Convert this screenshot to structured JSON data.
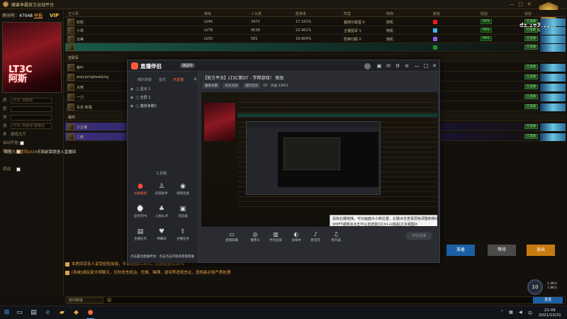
{
  "app": {
    "title": "魔兽争霸官方对战平台",
    "window_controls": [
      "—",
      "□",
      "✕"
    ]
  },
  "room": {
    "label": "房间号：",
    "number": "47048",
    "action": "举报",
    "vip": "VIP",
    "banner_text": "LT3C\n阿斯",
    "fields": [
      {
        "label": "房",
        "value": "LT3C 阿斯好"
      },
      {
        "label": "密",
        "value": ""
      },
      {
        "label": "类",
        "value": ""
      },
      {
        "label": "说",
        "value": "LT3C 阿斯好 联赛前"
      },
      {
        "label": "来",
        "value": "游戏大厅"
      },
      {
        "label": "自动开始",
        "value": ""
      },
      {
        "label": "裁判",
        "value": ""
      },
      {
        "label": "观战",
        "value": ""
      }
    ],
    "welcome": "欢迎",
    "welcome_user": "大部管司",
    "welcome_level": "LV14",
    "welcome_suffix": "天局前荣提进入直播间"
  },
  "table": {
    "headers": [
      "王父军",
      "等级",
      "人头数",
      "胜率率",
      "阵营",
      "种族",
      "颜色",
      "经验",
      "状态"
    ],
    "team_a": "王父军",
    "team_b": "亚联军",
    "spectators": "裁判",
    "rows": [
      {
        "name": "奶粉",
        "level": "LV46",
        "count": "3473",
        "rate": "17.161%",
        "camp": "塞西尔联盟 II",
        "race": "随机",
        "color": "#e8221a",
        "exp": "96%",
        "status": "已准备"
      },
      {
        "name": "小草",
        "level": "LV78",
        "count": "9539",
        "rate": "22.961%",
        "camp": "主播盟军 V",
        "race": "随机",
        "color": "#3fb7e8",
        "exp": "98%",
        "status": "已准备"
      },
      {
        "name": "瓜蒂",
        "level": "LV30",
        "count": "581",
        "rate": "19.604%",
        "camp": "阳帝归联 II",
        "race": "随机",
        "color": "#8d5be0",
        "exp": "98%",
        "status": "已准备"
      },
      {
        "name": "",
        "level": "",
        "count": "",
        "rate": "",
        "camp": "",
        "race": "",
        "color": "#1d8f2a",
        "exp": "",
        "status": "已准备"
      },
      {
        "name": "",
        "level": "",
        "count": "",
        "rate": "",
        "camp": "",
        "race": "",
        "color": "",
        "exp": "",
        "status": ""
      },
      {
        "name": "柳叶",
        "level": "",
        "count": "",
        "rate": "",
        "camp": "",
        "race": "",
        "color": "#e9d22b",
        "exp": "",
        "status": "已准备"
      },
      {
        "name": "waiyipingtwaiqing",
        "level": "",
        "count": "",
        "rate": "",
        "camp": "",
        "race": "",
        "color": "",
        "exp": "",
        "status": "已准备"
      },
      {
        "name": "大佬",
        "level": "",
        "count": "",
        "rate": "",
        "camp": "",
        "race": "",
        "color": "",
        "exp": "",
        "status": "已准备"
      },
      {
        "name": "一刀",
        "level": "",
        "count": "",
        "rate": "",
        "camp": "",
        "race": "",
        "color": "",
        "exp": "",
        "status": "已准备"
      },
      {
        "name": "东京 新福",
        "level": "",
        "count": "",
        "rate": "",
        "camp": "",
        "race": "",
        "color": "",
        "exp": "",
        "status": "已准备"
      },
      {
        "name": "",
        "level": "",
        "count": "",
        "rate": "",
        "camp": "",
        "race": "",
        "color": "",
        "exp": "",
        "status": ""
      },
      {
        "name": "小主播",
        "level": "",
        "count": "",
        "rate": "",
        "camp": "",
        "race": "",
        "color": "",
        "exp": "",
        "status": "已准备"
      },
      {
        "name": "二郎",
        "level": "",
        "count": "",
        "rate": "",
        "camp": "",
        "race": "",
        "color": "",
        "exp": "",
        "status": "已准备"
      }
    ]
  },
  "brand": {
    "site": "dz.163.com",
    "sub": "魔兽争霸官方对战平台"
  },
  "stream": {
    "app_name": "直播伴侣",
    "version": "测试中",
    "title": "【官方平台】LT3C第DT - 学帮游戏！ 修改",
    "tabs": [
      "我的场景",
      "音乐",
      "开直播"
    ],
    "scenes": [
      "显示 1",
      "全屏 1",
      "魔兽争霸3"
    ],
    "tools_title": "工具箱",
    "tools": [
      {
        "icon": "record-icon",
        "glyph": "●",
        "label": "录屏截图"
      },
      {
        "icon": "person-icon",
        "glyph": "♙",
        "label": "房管助手"
      },
      {
        "icon": "camera-icon",
        "glyph": "◉",
        "label": "视频连麦"
      },
      {
        "icon": "fps-icon",
        "glyph": "⌚",
        "label": "全民开PK"
      },
      {
        "icon": "game-icon",
        "glyph": "♣",
        "label": "斗鱼buff"
      },
      {
        "icon": "browser-icon",
        "glyph": "▣",
        "label": "浏览器"
      },
      {
        "icon": "window-icon",
        "glyph": "▤",
        "label": "主播任务"
      },
      {
        "icon": "gift-icon",
        "glyph": "♥",
        "label": "弹幕助"
      },
      {
        "icon": "upload-icon",
        "glyph": "⇪",
        "label": "主播任务"
      }
    ],
    "tags": [
      "魔兽争霸",
      "综合对战",
      "福利活动",
      "DT - 对战",
      "33911"
    ],
    "edit": "修改",
    "bottom_bar": [
      {
        "glyph": "▭",
        "label": "直播屏幕"
      },
      {
        "glyph": "◎",
        "label": "摄像头"
      },
      {
        "glyph": "▥",
        "label": "手机投屏"
      },
      {
        "glyph": "◐",
        "label": "多媒体"
      },
      {
        "glyph": "♪",
        "label": "麦克风"
      },
      {
        "glyph": "♫",
        "label": "扬声器"
      }
    ],
    "start_button": "开始直播",
    "tooltip": "鼠标右键拖拽，可对画面大小和位置，右键点击查看层级调整和移动，SHIFT或移动点击可以自选窗口Ctrl+V粘贴文本或图片",
    "bottom_hint": "点击置顶直播伴侣：点击点击可联系客服客服"
  },
  "chat": [
    "本房间享有人享受经验加成，平台经验x130%，同房经验x130%",
    "[系统]请玩家文明聊天，切勿发言政治、色情、赌博、谩骂等违规言论，违规者必将严肃处理"
  ],
  "input": {
    "channel": "房间频道",
    "send": "发送"
  },
  "buttons": {
    "prepare": "准备",
    "wait": "等待",
    "quit": "退出"
  },
  "network": {
    "gauge": "10",
    "up": "1.4K/s",
    "down": "1.8K/s"
  },
  "taskbar": {
    "time": "21:49",
    "date": "2021/10/31"
  }
}
